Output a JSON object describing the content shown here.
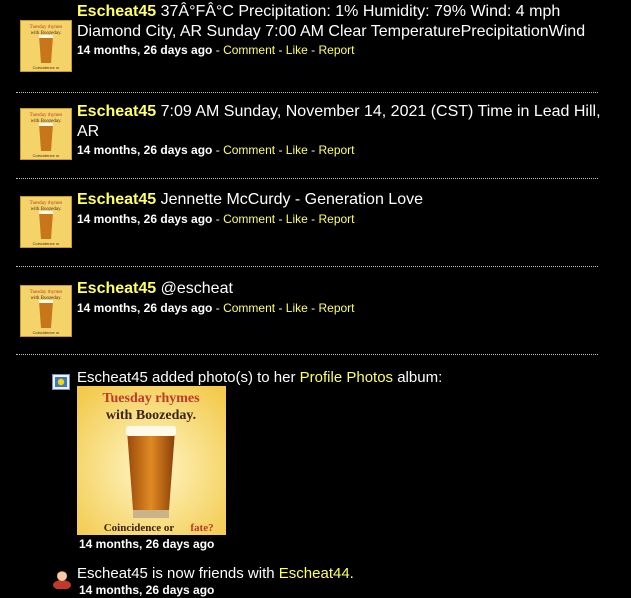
{
  "posts": [
    {
      "user": "Escheat45",
      "text": "37Â°FÂ°C Precipitation: 1% Humidity: 79% Wind: 4 mph Diamond City, AR Sunday 7:00 AM Clear TemperaturePrecipitationWind",
      "time": "14 months, 26 days ago",
      "comment": "Comment",
      "like": "Like",
      "report": "Report"
    },
    {
      "user": "Escheat45",
      "text": "7:09 AM Sunday, November 14, 2021 (CST) Time in Lead Hill, AR",
      "time": "14 months, 26 days ago",
      "comment": "Comment",
      "like": "Like",
      "report": "Report"
    },
    {
      "user": "Escheat45",
      "text": "Jennette McCurdy - Generation Love",
      "time": "14 months, 26 days ago",
      "comment": "Comment",
      "like": "Like",
      "report": "Report"
    },
    {
      "user": "Escheat45",
      "text": "@escheat",
      "time": "14 months, 26 days ago",
      "comment": "Comment",
      "like": "Like",
      "report": "Report"
    }
  ],
  "avatar_text": {
    "top": "Tuesday rhymes",
    "middle": "with Boozeday.",
    "bottom_a": "Coincidence or",
    "bottom_b": "fate?"
  },
  "activity_photo": {
    "prefix": "Escheat45 added photo(s) to her",
    "link": "Profile Photos",
    "suffix": "album:",
    "time": "14 months, 26 days ago"
  },
  "activity_friend": {
    "prefix": "Escheat45 is now friends with",
    "link": "Escheat44",
    "suffix": ".",
    "time": "14 months, 26 days ago"
  },
  "colors": {
    "background": "#000000",
    "link": "#ffff66",
    "text": "#ffffff"
  }
}
